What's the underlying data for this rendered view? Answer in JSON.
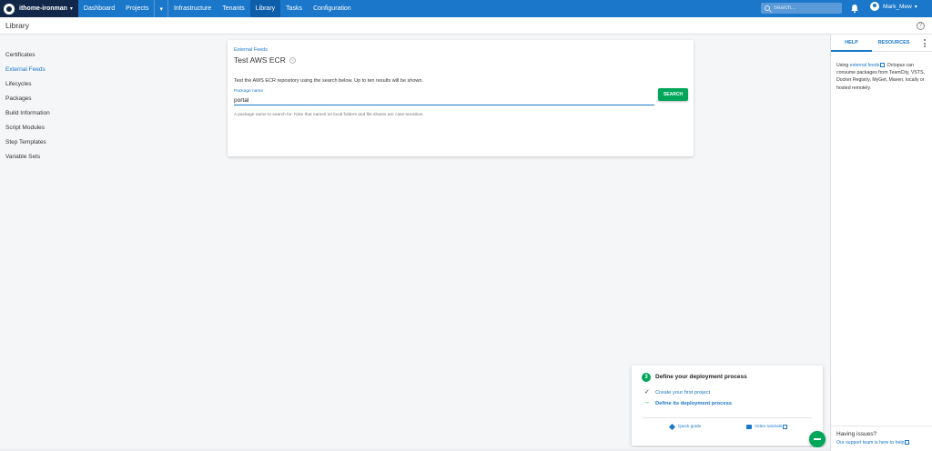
{
  "topnav": {
    "space_name": "ithome-ironman",
    "items": [
      "Dashboard",
      "Projects",
      "Infrastructure",
      "Tenants",
      "Library",
      "Tasks",
      "Configuration"
    ],
    "active": "Library",
    "search_placeholder": "Search...",
    "user_name": "Mark_Mew",
    "colors": {
      "brand": "#1a77ca",
      "space_bg": "#12284a"
    }
  },
  "page": {
    "title": "Library"
  },
  "sidebar": {
    "items": [
      "Certificates",
      "External Feeds",
      "Lifecycles",
      "Packages",
      "Build Information",
      "Script Modules",
      "Step Templates",
      "Variable Sets"
    ],
    "active": "External Feeds"
  },
  "card": {
    "breadcrumb": "External Feeds",
    "title": "Test AWS ECR",
    "description": "Test the AWS ECR repository using the search below. Up to ten results will be shown.",
    "field_label": "Package name",
    "field_value": "portal",
    "hint": "A package name to search for. Note that names on local folders and file shares are case-sensitive.",
    "search_button": "SEARCH",
    "button_color": "#00a65a"
  },
  "help_panel": {
    "tabs": [
      "HELP",
      "RESOURCES"
    ],
    "body_prefix": "Using ",
    "body_link": "external feeds",
    "body_suffix": " Octopus can consume packages from TeamCity, VSTS, Docker Registry, MyGet, Maven, locally or hosted remotely.",
    "issues_title": "Having issues?",
    "issues_link": "Our support team is here to help"
  },
  "onboarding": {
    "step": "3",
    "title": "Define your deployment process",
    "tasks": [
      "Create your first project",
      "Define its deployment process"
    ],
    "footer": [
      "Quick guide",
      "Video tutorials"
    ]
  }
}
